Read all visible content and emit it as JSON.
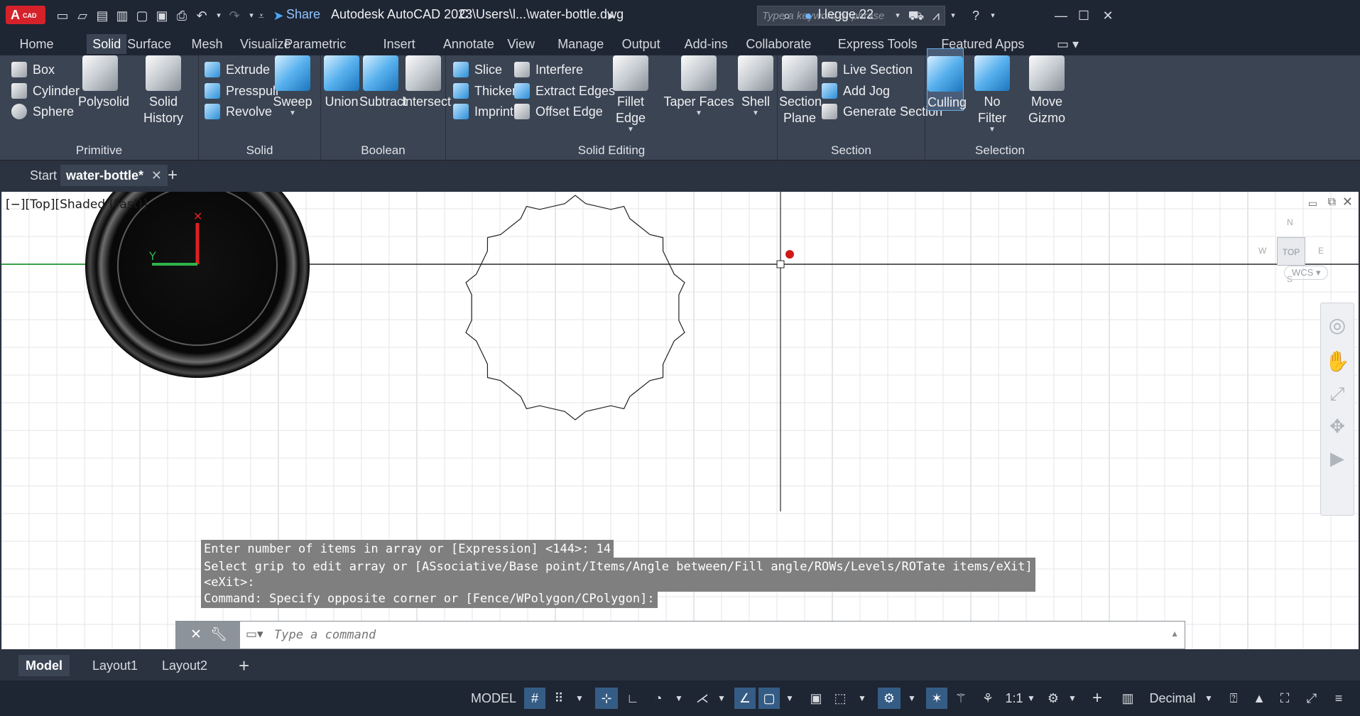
{
  "app": {
    "logo_text": "A",
    "logo_sub": "CAD",
    "title": "Autodesk AutoCAD 2023",
    "file_path": "C:\\Users\\l...\\water-bottle.dwg",
    "share_label": "Share",
    "search_placeholder": "Type a keyword or phrase",
    "user": "l.legge.22"
  },
  "ribbon_tabs": [
    "Home",
    "Solid",
    "Surface",
    "Mesh",
    "Visualize",
    "Parametric",
    "Insert",
    "Annotate",
    "View",
    "Manage",
    "Output",
    "Add-ins",
    "Collaborate",
    "Express Tools",
    "Featured Apps"
  ],
  "active_ribbon_tab": "Solid",
  "ribbon": {
    "primitive": {
      "title": "Primitive",
      "box": "Box",
      "cylinder": "Cylinder",
      "sphere": "Sphere",
      "polysolid": "Polysolid",
      "solid_history": "Solid History"
    },
    "solid": {
      "title": "Solid",
      "extrude": "Extrude",
      "presspull": "Presspull",
      "revolve": "Revolve",
      "sweep": "Sweep"
    },
    "boolean": {
      "title": "Boolean",
      "union": "Union",
      "subtract": "Subtract",
      "intersect": "Intersect"
    },
    "solid_editing": {
      "title": "Solid Editing",
      "slice": "Slice",
      "thicken": "Thicken",
      "imprint": "Imprint",
      "interfere": "Interfere",
      "extract_edges": "Extract Edges",
      "offset_edge": "Offset Edge",
      "fillet_edge": "Fillet Edge",
      "taper_faces": "Taper Faces",
      "shell": "Shell"
    },
    "section": {
      "title": "Section",
      "section_plane_1": "Section",
      "section_plane_2": "Plane",
      "live_section": "Live Section",
      "add_jog": "Add Jog",
      "generate_section": "Generate Section"
    },
    "selection": {
      "title": "Selection",
      "culling": "Culling",
      "no_filter": "No Filter",
      "move_gizmo_1": "Move",
      "move_gizmo_2": "Gizmo"
    }
  },
  "doc_tabs": {
    "start": "Start",
    "active": "water-bottle*"
  },
  "viewport": {
    "label": "[−][Top][Shaded (Fast)]",
    "wcs": "WCS",
    "viewcube_top": "TOP",
    "compass_n": "N",
    "compass_s": "S",
    "compass_e": "E",
    "compass_w": "W"
  },
  "command_history": [
    "Enter number of items in array or [Expression] <144>: 14",
    "Select grip to edit array or [ASsociative/Base point/Items/Angle between/Fill angle/ROWs/Levels/ROTate items/eXit]\n<eXit>:",
    "Command: Specify opposite corner or [Fence/WPolygon/CPolygon]:"
  ],
  "command_placeholder": "Type a command",
  "layout_tabs": {
    "model": "Model",
    "layout1": "Layout1",
    "layout2": "Layout2"
  },
  "status": {
    "model": "MODEL",
    "scale": "1:1",
    "units": "Decimal"
  }
}
